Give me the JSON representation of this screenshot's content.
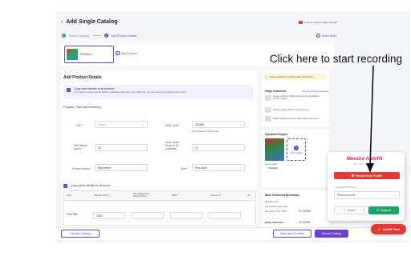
{
  "header": {
    "back_icon": "chevron-left-icon",
    "title": "Add Single Catalog",
    "help_link": "Learn to upload single catalog?",
    "need_help": "Need Help?"
  },
  "steps": [
    {
      "label": "Select Category",
      "state": "done"
    },
    {
      "num": "2",
      "label": "Add Product Details",
      "state": "active"
    }
  ],
  "product_tabs": {
    "product1": "Product 1",
    "add_product": "Add Product"
  },
  "form": {
    "section_title": "Add Product Details",
    "copy_checkbox": "Copy input details to all product",
    "copy_hint": "If you want to change specific fields for particular product like Color, Fabric etc, you can change it by selecting that product.",
    "size_inventory_title": "Product, Size and Inventory",
    "gst_label": "GST *",
    "gst_placeholder": "Select",
    "hsn_label": "HSN Code *",
    "hsn_value": "302490",
    "hsn_link": "Find Relevant HSN Code",
    "net_weight_label": "Net Weight (gms) *",
    "net_weight_value": "23",
    "style_code_label": "Style code/ Product ID (optional)",
    "style_code_value": "23",
    "product_name_label": "Product Name *",
    "product_name_value": "Nylonrevzr",
    "size_label": "Size *",
    "size_value": "Free Size",
    "copy_price_label": "Copy price details to all sizes",
    "table": {
      "headers": [
        "Size",
        "Meesho Price*",
        "Wrong/Defective Returns Price",
        "MRP*",
        "Inventory*",
        "Sk"
      ],
      "row_size": "Free Size",
      "row_price": "3232"
    }
  },
  "guidelines": {
    "notice": "Follow guidelines to reduce quality check failure",
    "title": "Image Guidelines",
    "view_full": "View Full Image Guidelines",
    "items": [
      "Images with text / Watermark are not acceptable in primary images.",
      "Product image should not have any text",
      "Please add solo product image without any props."
    ]
  },
  "uploaded": {
    "title": "Uploaded Images",
    "add_images": "Add Images",
    "front_image": "Front Image *",
    "change": "CHANGE"
  },
  "settlement": {
    "title": "Bank Settlement Breakdown",
    "meesho_price": "Meesho price",
    "commission": "Commission fee of 0%",
    "tax": "Tax (GST, TCS, TDS)",
    "price_value": "₹1,215.55",
    "bank_settlement": "Bank settlement",
    "bank_value": "₹1,215.55"
  },
  "footer": {
    "discard": "Discard Catalog",
    "save_back": "Save and Go Back",
    "submit": "Submit Catalog"
  },
  "popup": {
    "brand": "Meesho Autofill",
    "subtitle": "Smart fills in seconds",
    "record_btn": "Record New Profile",
    "profile_label": "CHANGE PROFILE",
    "profile_placeholder": "Select a profile...",
    "import": "Import",
    "support": "Support"
  },
  "fab": {
    "label": "Autofill Tool"
  },
  "annotation": {
    "text": "Click here to start recording"
  },
  "colors": {
    "accent": "#6a3fd6",
    "pink": "#e91e63",
    "red": "#e53935",
    "green": "#1ea36a"
  }
}
